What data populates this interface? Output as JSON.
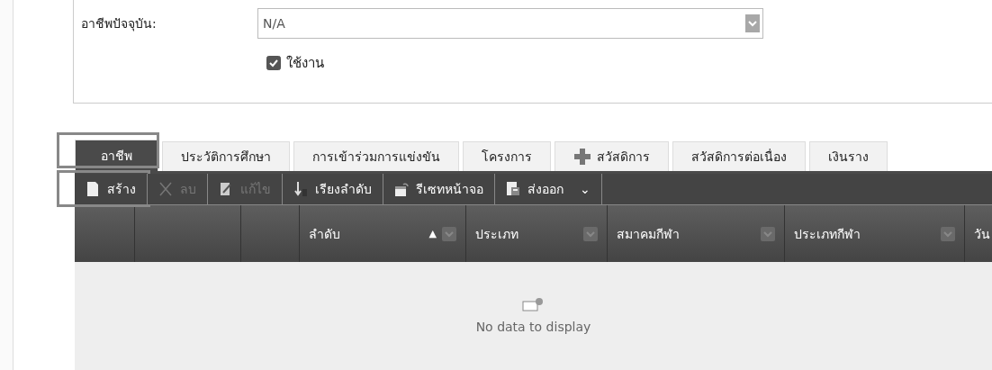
{
  "form": {
    "occupation_label": "อาชีพปัจจุบัน:",
    "occupation_value": "N/A",
    "active": {
      "label": "ใช้งาน",
      "checked": true
    }
  },
  "tabs": [
    {
      "label": "อาชีพ",
      "selected": true,
      "highlighted": true
    },
    {
      "label": "ประวัติการศึกษา",
      "selected": false,
      "highlighted": false
    },
    {
      "label": "การเข้าร่วมการแข่งขัน",
      "selected": false,
      "highlighted": false
    },
    {
      "label": "โครงการ",
      "selected": false,
      "highlighted": false
    },
    {
      "label": "สวัสดิการ",
      "selected": false,
      "highlighted": false
    },
    {
      "label": "สวัสดิการต่อเนื่อง",
      "selected": false,
      "highlighted": false
    },
    {
      "label": "เงินราง",
      "selected": false,
      "highlighted": false
    }
  ],
  "toolbar": [
    {
      "label": "สร้าง",
      "disabled": false,
      "highlighted": true
    },
    {
      "label": "ลบ",
      "disabled": true,
      "highlighted": false
    },
    {
      "label": "แก้ไข",
      "disabled": true,
      "highlighted": false
    },
    {
      "label": "เรียงลำดับ",
      "disabled": false,
      "highlighted": false
    },
    {
      "label": "รีเซทหน้าจอ",
      "disabled": false,
      "highlighted": false
    },
    {
      "label": "ส่งออก",
      "disabled": false,
      "highlighted": false,
      "dropdown": "⌄"
    }
  ],
  "table": {
    "columns": [
      {
        "kind": "blank"
      },
      {
        "kind": "blank"
      },
      {
        "kind": "blank"
      },
      {
        "kind": "data",
        "label": "ลำดับ",
        "sort": "▲"
      },
      {
        "kind": "data",
        "label": "ประเภท"
      },
      {
        "kind": "data",
        "label": "สมาคมกีฬา"
      },
      {
        "kind": "data",
        "label": "ประเภทกีฬา"
      },
      {
        "kind": "cut",
        "label": "วัน"
      }
    ],
    "empty_text": "No data to display"
  }
}
